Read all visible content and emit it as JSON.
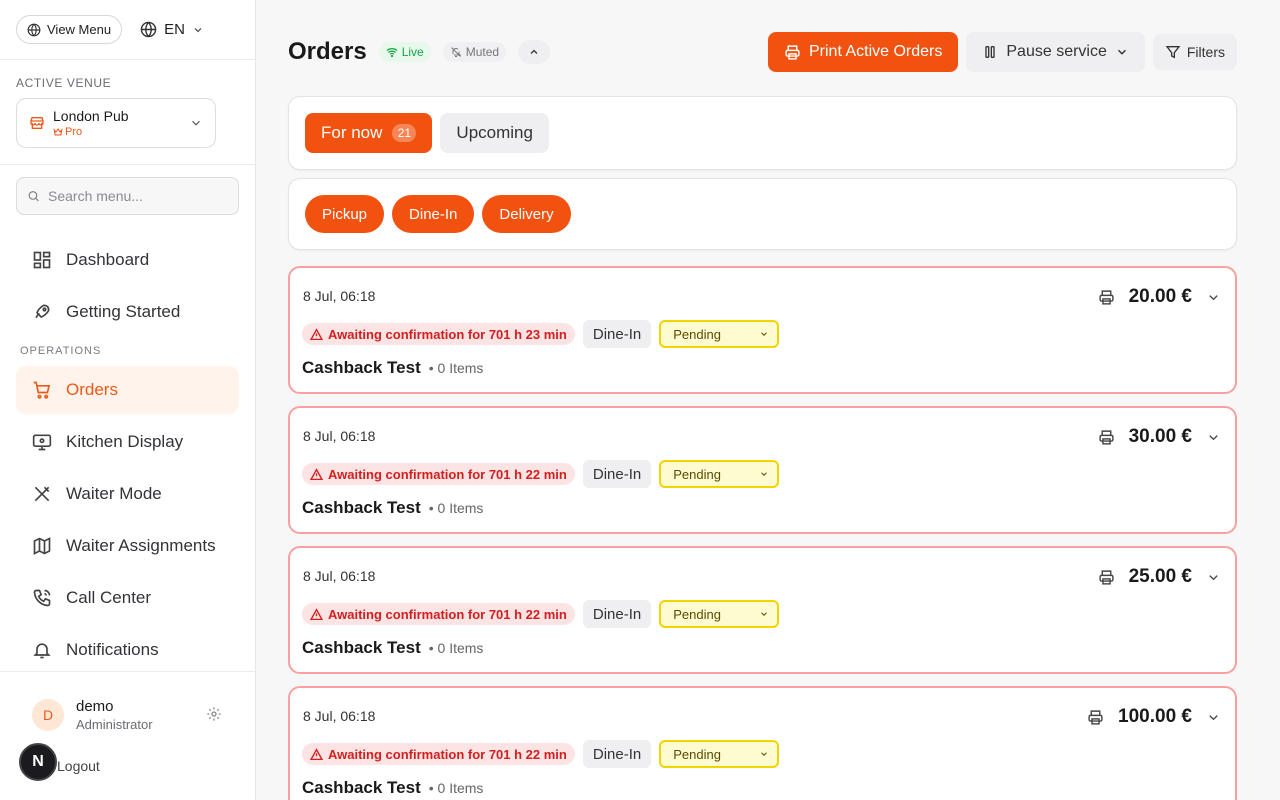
{
  "sidebar": {
    "view_menu": "View Menu",
    "language": "EN",
    "active_venue_label": "ACTIVE VENUE",
    "venue": {
      "name": "London Pub",
      "plan": "Pro"
    },
    "search_placeholder": "Search menu...",
    "nav": [
      {
        "label": "Dashboard",
        "icon": "dashboard-icon"
      },
      {
        "label": "Getting Started",
        "icon": "rocket-icon"
      }
    ],
    "operations_label": "OPERATIONS",
    "ops_nav": [
      {
        "label": "Orders",
        "icon": "cart-icon",
        "active": true
      },
      {
        "label": "Kitchen Display",
        "icon": "monitor-icon"
      },
      {
        "label": "Waiter Mode",
        "icon": "utensils-icon"
      },
      {
        "label": "Waiter Assignments",
        "icon": "map-icon"
      },
      {
        "label": "Call Center",
        "icon": "phone-icon"
      },
      {
        "label": "Notifications",
        "icon": "bell-icon"
      }
    ],
    "user": {
      "initial": "D",
      "name": "demo",
      "role": "Administrator"
    },
    "logout": "Logout",
    "floating_badge": "N"
  },
  "header": {
    "title": "Orders",
    "live": "Live",
    "muted": "Muted",
    "print_button": "Print Active Orders",
    "pause_button": "Pause service",
    "filters_button": "Filters"
  },
  "tabs": {
    "now_label": "For now",
    "now_count": "21",
    "upcoming_label": "Upcoming"
  },
  "order_types": [
    "Pickup",
    "Dine-In",
    "Delivery"
  ],
  "orders": [
    {
      "date": "8 Jul, 06:18",
      "alert": "Awaiting confirmation for 701 h 23 min",
      "type": "Dine-In",
      "status": "Pending",
      "customer": "Cashback Test",
      "items": "• 0 Items",
      "total": "20.00 €"
    },
    {
      "date": "8 Jul, 06:18",
      "alert": "Awaiting confirmation for 701 h 22 min",
      "type": "Dine-In",
      "status": "Pending",
      "customer": "Cashback Test",
      "items": "• 0 Items",
      "total": "30.00 €"
    },
    {
      "date": "8 Jul, 06:18",
      "alert": "Awaiting confirmation for 701 h 22 min",
      "type": "Dine-In",
      "status": "Pending",
      "customer": "Cashback Test",
      "items": "• 0 Items",
      "total": "25.00 €"
    },
    {
      "date": "8 Jul, 06:18",
      "alert": "Awaiting confirmation for 701 h 22 min",
      "type": "Dine-In",
      "status": "Pending",
      "customer": "Cashback Test",
      "items": "• 0 Items",
      "total": "100.00 €"
    }
  ],
  "colors": {
    "accent": "#f2520f",
    "active_nav_bg": "#fff3eb",
    "alert_bg": "#fde4e4",
    "alert_text": "#d11f1f",
    "pending_bg": "#fffbd0",
    "pending_border": "#f2d500",
    "order_border": "#f8a0a0",
    "live_green": "#18a34a"
  }
}
